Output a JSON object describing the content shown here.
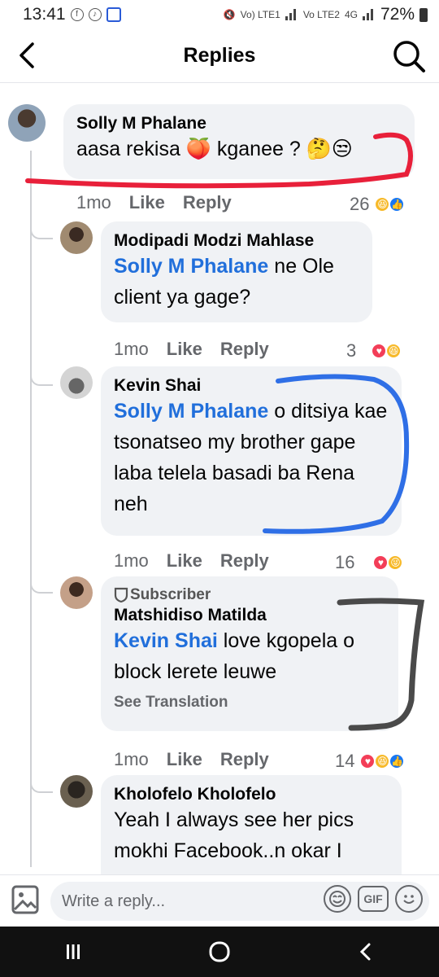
{
  "status_bar": {
    "time": "13:41",
    "battery": "72%",
    "network_labels": [
      "Vo) LTE1",
      "Vo LTE2",
      "4G"
    ]
  },
  "header": {
    "title": "Replies"
  },
  "comments": [
    {
      "author": "Solly M Phalane",
      "text": "aasa rekisa 🍑 kganee ? 🤔😒",
      "time": "1mo",
      "like": "Like",
      "reply": "Reply",
      "reactions": "26"
    },
    {
      "author": "Modipadi Modzi Mahlase",
      "mention": "Solly M Phalane",
      "text": " ne Ole client ya gage?",
      "time": "1mo",
      "like": "Like",
      "reply": "Reply",
      "reactions": "3"
    },
    {
      "author": "Kevin Shai",
      "mention": "Solly M Phalane",
      "text": " o ditsiya kae tsonatseo my brother gape laba telela basadi ba Rena neh",
      "time": "1mo",
      "like": "Like",
      "reply": "Reply",
      "reactions": "16"
    },
    {
      "badge": "Subscriber",
      "author": "Matshidiso Matilda",
      "mention": "Kevin Shai",
      "text": " love kgopela o block lerete leuwe",
      "see_translation": "See Translation",
      "time": "1mo",
      "like": "Like",
      "reply": "Reply",
      "reactions": "14"
    },
    {
      "author": "Kholofelo Kholofelo",
      "text": "Yeah I always see her pics mokhi Facebook..n okar I"
    }
  ],
  "composer": {
    "placeholder": "Write a reply...",
    "gif_label": "GIF"
  },
  "colors": {
    "mention": "#216fdb",
    "bubble": "#f0f2f5",
    "annotation_red": "#e8203a",
    "annotation_blue": "#2f6fe6",
    "annotation_dark": "#4a4a4a"
  },
  "icons": [
    "back-arrow-icon",
    "search-icon",
    "photo-icon",
    "sticker-icon",
    "gif-icon",
    "emoji-icon",
    "recents-icon",
    "home-icon",
    "nav-back-icon"
  ]
}
